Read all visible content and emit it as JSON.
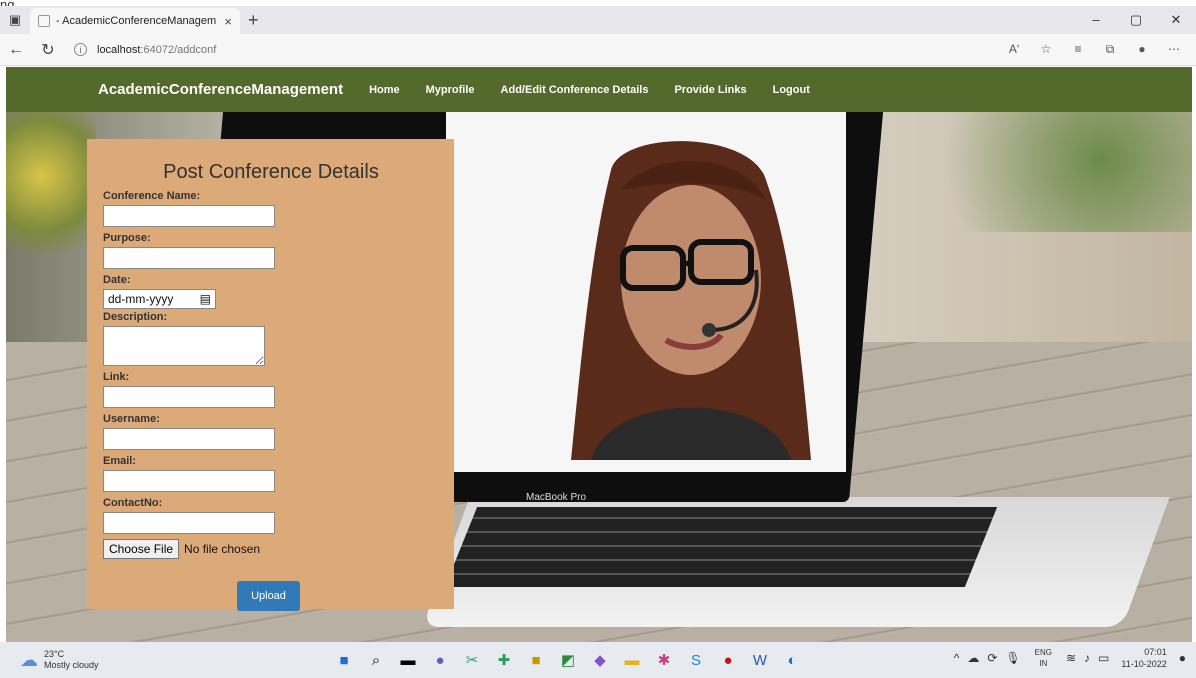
{
  "stray_text": "ng",
  "browser": {
    "tab_title": "- AcademicConferenceManagem",
    "tab_close": "×",
    "new_tab": "+",
    "url_host": "localhost",
    "url_path": ":64072/addconf",
    "read_aloud": "Aʹ",
    "win_min": "–",
    "win_max": "▢",
    "win_close": "✕"
  },
  "site": {
    "brand": "AcademicConferenceManagement",
    "nav": [
      "Home",
      "Myprofile",
      "Add/Edit Conference Details",
      "Provide Links",
      "Logout"
    ]
  },
  "laptop_label": "MacBook Pro",
  "form": {
    "title": "Post Conference Details",
    "labels": {
      "name": "Conference Name:",
      "purpose": "Purpose:",
      "date": "Date:",
      "description": "Description:",
      "link": "Link:",
      "username": "Username:",
      "email": "Email:",
      "contact": "ContactNo:"
    },
    "date_placeholder": "dd-mm-yyyy",
    "choose_file": "Choose File",
    "no_file": "No file chosen",
    "upload": "Upload"
  },
  "taskbar": {
    "temp": "23°C",
    "weather": "Mostly cloudy",
    "lang1": "ENG",
    "lang2": "IN",
    "time": "07:01",
    "date": "11-10-2022"
  }
}
